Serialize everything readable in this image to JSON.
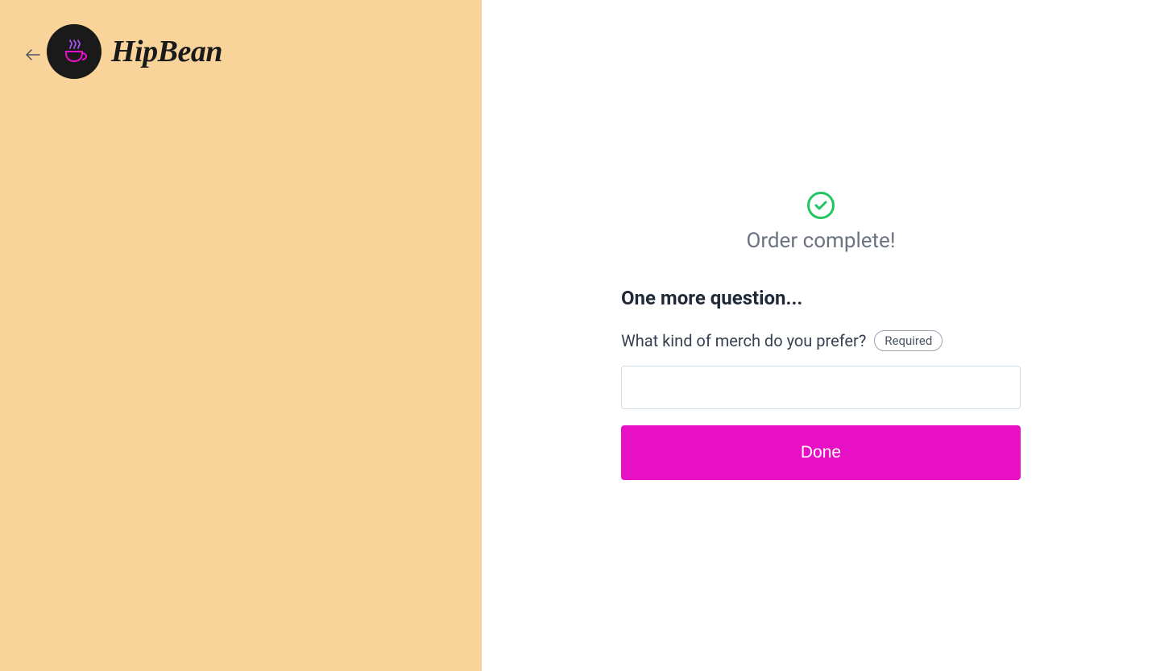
{
  "brand": {
    "name": "HipBean"
  },
  "success": {
    "message": "Order complete!"
  },
  "question": {
    "heading": "One more question...",
    "text": "What kind of merch do you prefer?",
    "required_label": "Required",
    "answer_value": ""
  },
  "actions": {
    "done_label": "Done"
  },
  "colors": {
    "left_panel_bg": "#f8d49a",
    "primary_button": "#e810c5",
    "success_green": "#22c55e"
  }
}
